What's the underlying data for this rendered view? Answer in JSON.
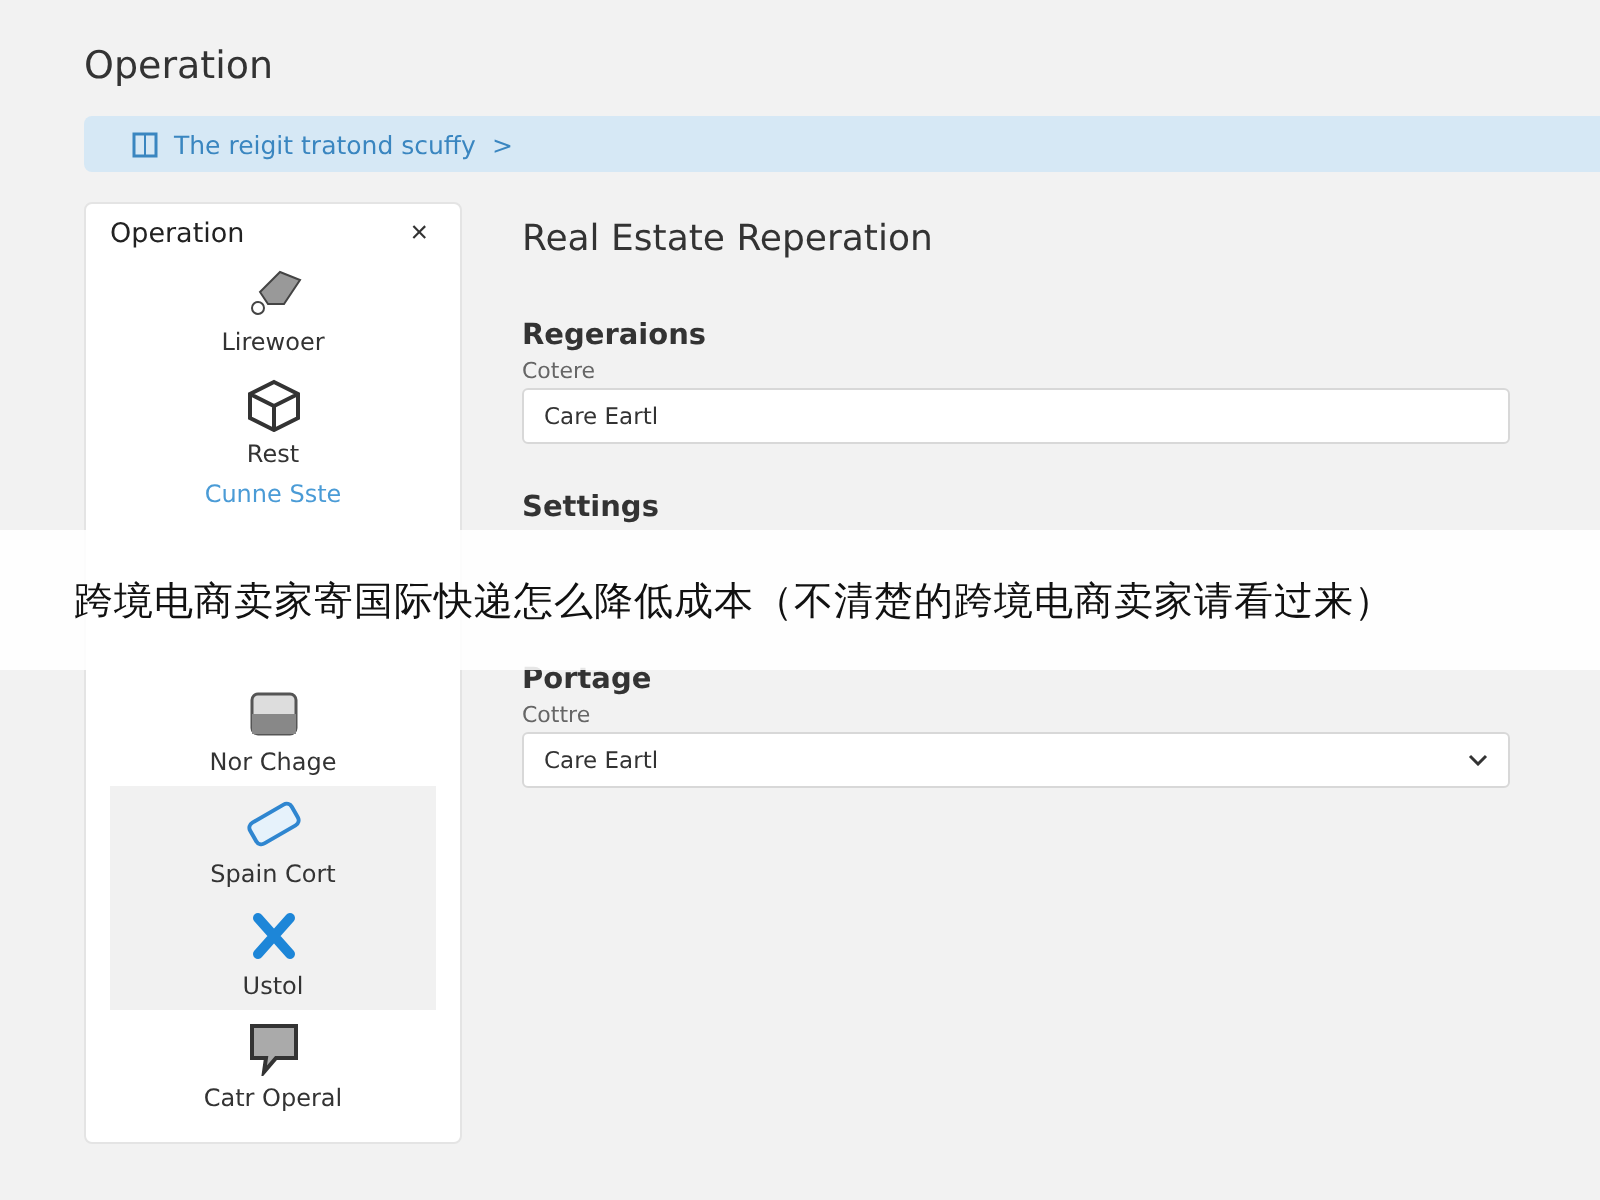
{
  "page_title": "Operation",
  "notice": {
    "text": "The reigit tratond scuffy",
    "chevron": ">"
  },
  "sidebar": {
    "title": "Operation",
    "close": "×",
    "items": [
      {
        "label": "Lirewoer",
        "kind": "tag",
        "selected": false,
        "accent": false
      },
      {
        "label": "Rest",
        "kind": "box",
        "selected": false,
        "accent": false
      },
      {
        "label": "Cunne Sste",
        "kind": "hidden",
        "selected": false,
        "accent": true
      },
      {
        "label": "Nor Chage",
        "kind": "tray",
        "selected": false,
        "accent": false
      },
      {
        "label": "Spain Cort",
        "kind": "ticket",
        "selected": true,
        "accent": false
      },
      {
        "label": "Ustol",
        "kind": "cross",
        "selected": true,
        "accent": false
      },
      {
        "label": "Catr Operal",
        "kind": "monitor",
        "selected": false,
        "accent": false
      }
    ]
  },
  "main": {
    "title": "Real Estate Reperation",
    "sections": [
      {
        "heading": "Regeraions",
        "label": "Cotere",
        "value": "Care Eartl",
        "kind": "text"
      },
      {
        "heading": "Settings",
        "kind": "covered"
      },
      {
        "heading": "Portage",
        "label": "Cottre",
        "value": "Care Eartl",
        "kind": "select"
      }
    ]
  },
  "overlay_caption": "跨境电商卖家寄国际快递怎么降低成本（不清楚的跨境电商卖家请看过来）"
}
